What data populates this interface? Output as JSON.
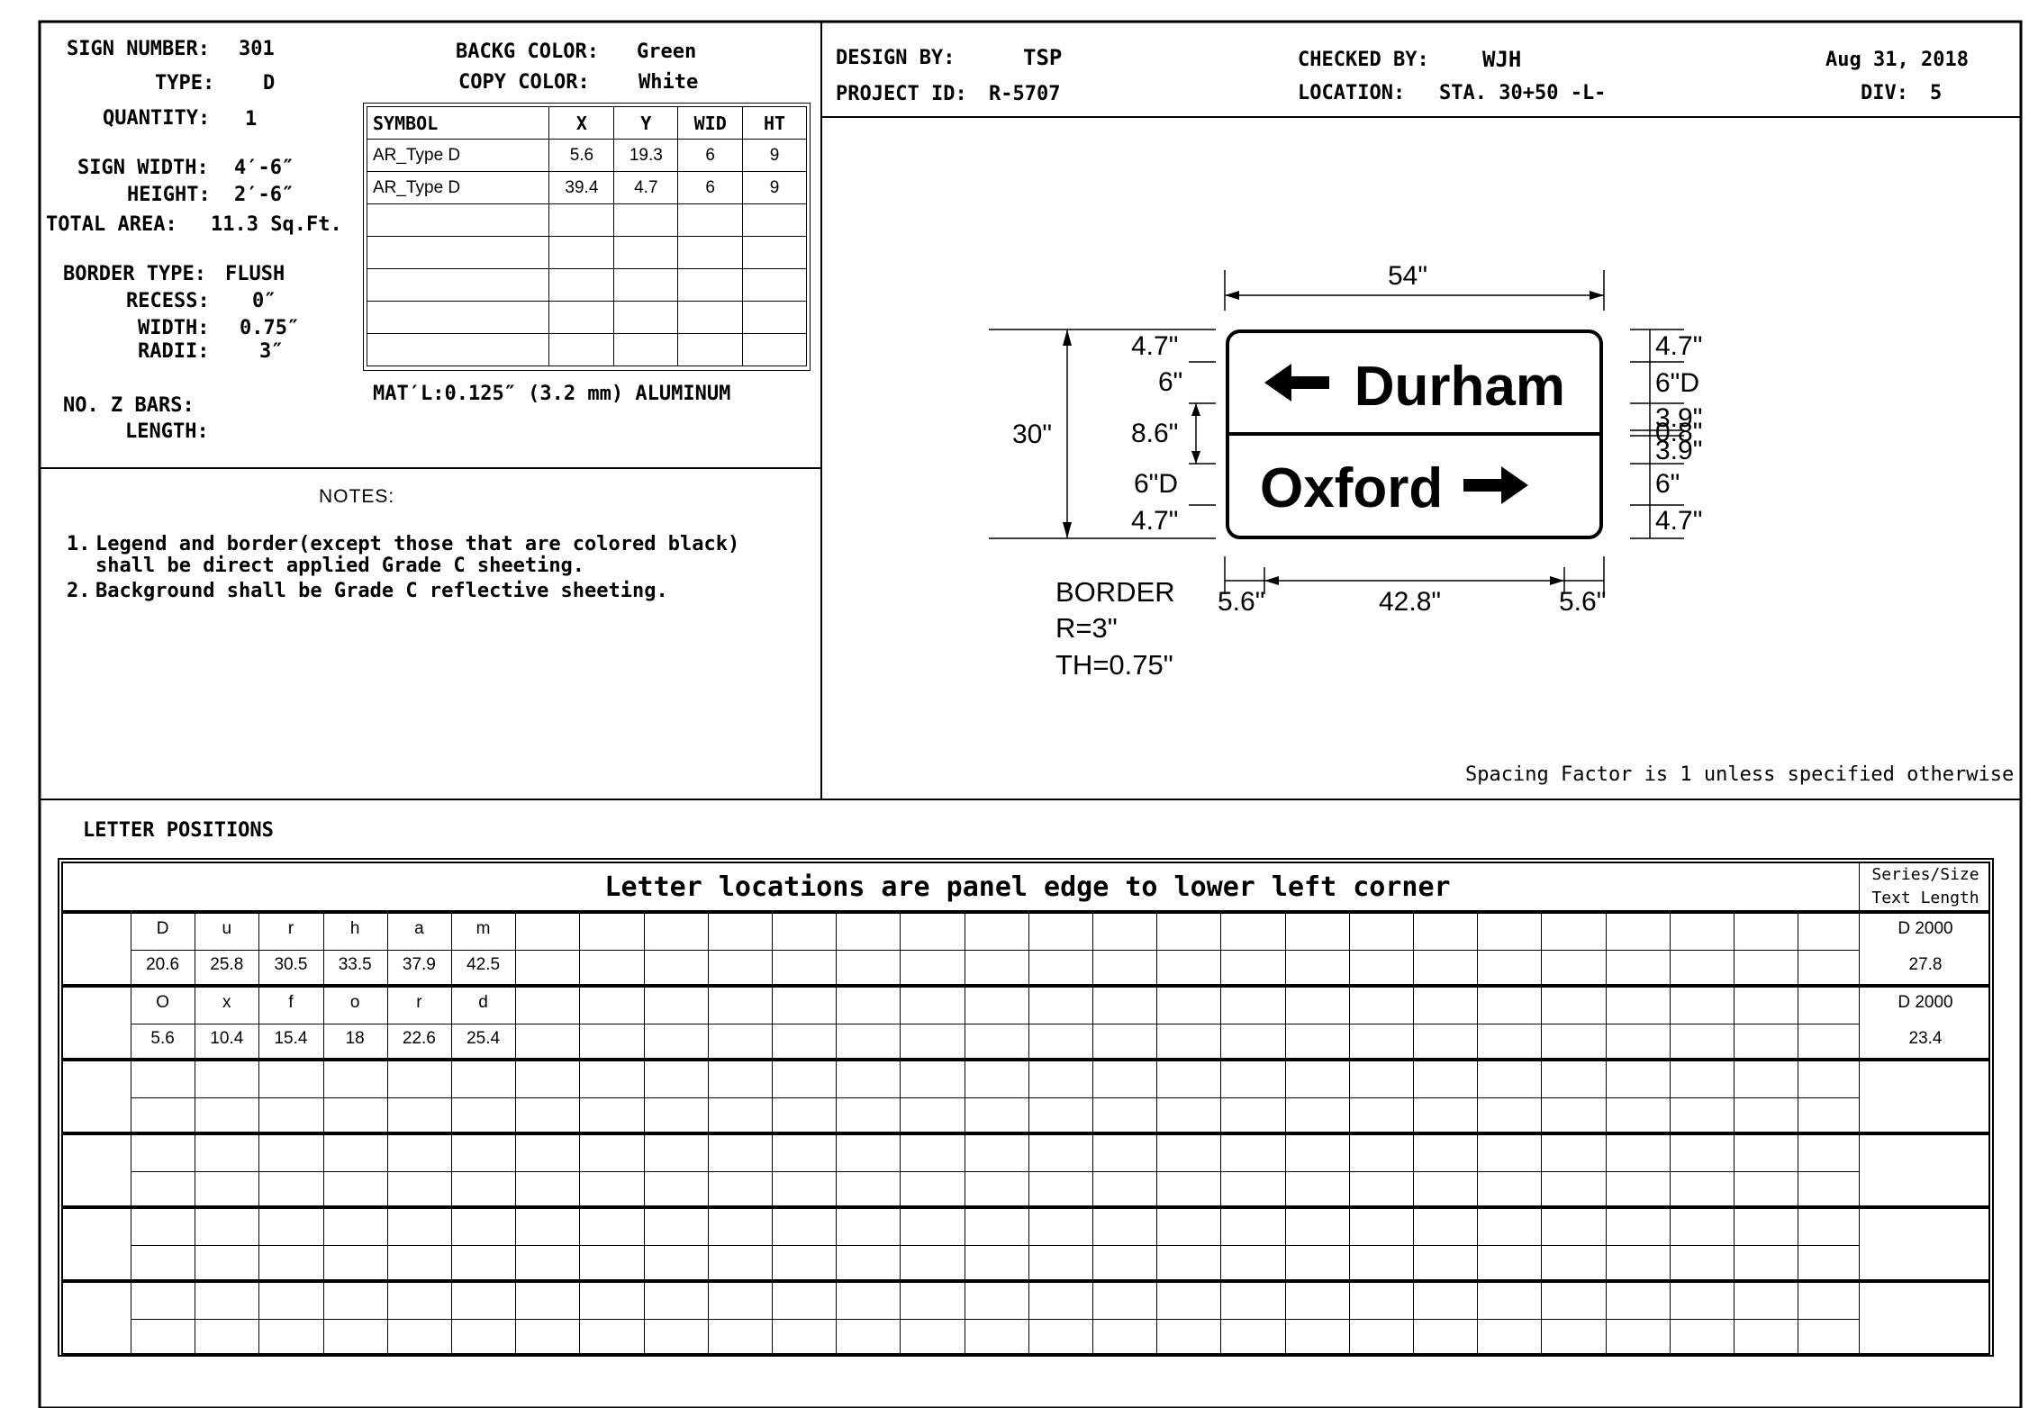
{
  "sign_info": {
    "sign_number_label": "SIGN NUMBER:",
    "sign_number": "301",
    "type_label": "TYPE:",
    "type": "D",
    "quantity_label": "QUANTITY:",
    "quantity": "1",
    "sign_width_label": "SIGN WIDTH:",
    "sign_width": "4′-6″",
    "height_label": "HEIGHT:",
    "height": "2′-6″",
    "total_area_label": "TOTAL AREA:",
    "total_area": "11.3 Sq.Ft.",
    "border_type_label": "BORDER TYPE:",
    "border_type": "FLUSH",
    "recess_label": "RECESS:",
    "recess": "0″",
    "width_label": "WIDTH:",
    "width": "0.75″",
    "radii_label": "RADII:",
    "radii": "3″",
    "z_bars_label": "NO.  Z BARS:",
    "length_label": "LENGTH:"
  },
  "colors": {
    "backg_label": "BACKG COLOR:",
    "backg": "Green",
    "copy_label": "COPY COLOR:",
    "copy": "White"
  },
  "symbol_table": {
    "headers": [
      "SYMBOL",
      "X",
      "Y",
      "WID",
      "HT"
    ],
    "rows": [
      [
        "AR_Type D",
        "5.6",
        "19.3",
        "6",
        "9"
      ],
      [
        "AR_Type D",
        "39.4",
        "4.7",
        "6",
        "9"
      ],
      [
        "",
        "",
        "",
        "",
        ""
      ],
      [
        "",
        "",
        "",
        "",
        ""
      ],
      [
        "",
        "",
        "",
        "",
        ""
      ],
      [
        "",
        "",
        "",
        "",
        ""
      ],
      [
        "",
        "",
        "",
        "",
        ""
      ]
    ]
  },
  "material": "MAT′L:0.125″ (3.2 mm) ALUMINUM",
  "notes": {
    "title": "NOTES:",
    "items": [
      {
        "num": "1.",
        "line1": "Legend and border(except those that are colored black)",
        "line2": "shall be direct applied Grade C sheeting."
      },
      {
        "num": "2.",
        "line1": "Background shall be Grade C reflective sheeting.",
        "line2": ""
      }
    ]
  },
  "header": {
    "design_by_label": "DESIGN BY:",
    "design_by": "TSP",
    "project_id_label": "PROJECT ID:",
    "project_id": "R-5707",
    "checked_by_label": "CHECKED BY:",
    "checked_by": "WJH",
    "location_label": "LOCATION:",
    "location": "STA. 30+50 -L-",
    "date": "Aug 31, 2018",
    "div_label": "DIV:",
    "div": "5"
  },
  "sign": {
    "line1": "Durham",
    "line2": "Oxford",
    "arrow1": "left-arrow-icon",
    "arrow2": "right-arrow-icon"
  },
  "dimensions": {
    "width_total": "54\"",
    "height_total": "30\"",
    "left": [
      "4.7\"",
      "6\"",
      "8.6\"",
      "6\"D",
      "4.7\""
    ],
    "right": [
      "4.7\"",
      "6\"D",
      "3.9\"",
      "0.8\"",
      "3.9\"",
      "6\"",
      "4.7\""
    ],
    "bottom": [
      "5.6\"",
      "42.8\"",
      "5.6\""
    ],
    "border": [
      "BORDER",
      "R=3\"",
      "TH=0.75\""
    ]
  },
  "spacing_note": "Spacing Factor is 1 unless specified otherwise",
  "letter_positions": {
    "section_title": "LETTER POSITIONS",
    "table_title": "Letter locations are panel edge to lower left corner",
    "series_header_1": "Series/Size",
    "series_header_2": "Text Length",
    "rows": [
      {
        "letters": [
          "D",
          "u",
          "r",
          "h",
          "a",
          "m"
        ],
        "positions": [
          "20.6",
          "25.8",
          "30.5",
          "33.5",
          "37.9",
          "42.5"
        ],
        "series": "D 2000",
        "length": "27.8"
      },
      {
        "letters": [
          "O",
          "x",
          "f",
          "o",
          "r",
          "d"
        ],
        "positions": [
          "5.6",
          "10.4",
          "15.4",
          "18",
          "22.6",
          "25.4"
        ],
        "series": "D 2000",
        "length": "23.4"
      },
      {
        "letters": [],
        "positions": [],
        "series": "",
        "length": ""
      },
      {
        "letters": [],
        "positions": [],
        "series": "",
        "length": ""
      },
      {
        "letters": [],
        "positions": [],
        "series": "",
        "length": ""
      },
      {
        "letters": [],
        "positions": [],
        "series": "",
        "length": ""
      }
    ]
  }
}
